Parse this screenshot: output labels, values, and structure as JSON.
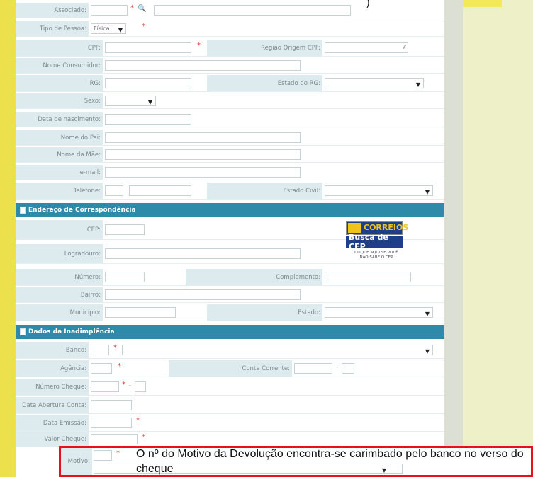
{
  "top_note": ")",
  "form": {
    "associado_label": "Associado:",
    "tipo_pessoa_label": "Tipo de Pessoa:",
    "tipo_pessoa_value": "Física",
    "cpf_label": "CPF:",
    "regiao_cpf_label": "Região Origem CPF:",
    "nome_consumidor_label": "Nome Consumidor:",
    "rg_label": "RG:",
    "estado_rg_label": "Estado do RG:",
    "sexo_label": "Sexo:",
    "data_nascimento_label": "Data de nascimento:",
    "nome_pai_label": "Nome do Pai:",
    "nome_mae_label": "Nome da Mãe:",
    "email_label": "e-mail:",
    "telefone_label": "Telefone:",
    "estado_civil_label": "Estado Civil:"
  },
  "endereco": {
    "title": "Endereço de Correspondência",
    "cep_label": "CEP:",
    "logradouro_label": "Logradouro:",
    "numero_label": "Número:",
    "complemento_label": "Complemento:",
    "bairro_label": "Bairro:",
    "municipio_label": "Município:",
    "estado_label": "Estado:"
  },
  "correios": {
    "brand": "CORREIOS",
    "busca": "Busca de CEP",
    "caption_1": "CLIQUE AQUI SE VOCÊ",
    "caption_2": "NÃO SABE O CEP"
  },
  "inadimplencia": {
    "title": "Dados da Inadimplência",
    "banco_label": "Banco:",
    "agencia_label": "Agência:",
    "conta_label": "Conta Corrente:",
    "numero_cheque_label": "Número Cheque:",
    "data_abertura_label": "Data Abertura Conta:",
    "data_emissao_label": "Data Emissão:",
    "valor_cheque_label": "Valor Cheque:",
    "motivo_label": "Motivo:"
  },
  "note": "O nº do Motivo da Devolução encontra-se carimbado pelo banco no verso do cheque",
  "colors": {
    "header": "#2d8aa8",
    "label_bg": "#ddeaee",
    "highlight_border": "#e8101a",
    "required": "#e23b3b"
  }
}
